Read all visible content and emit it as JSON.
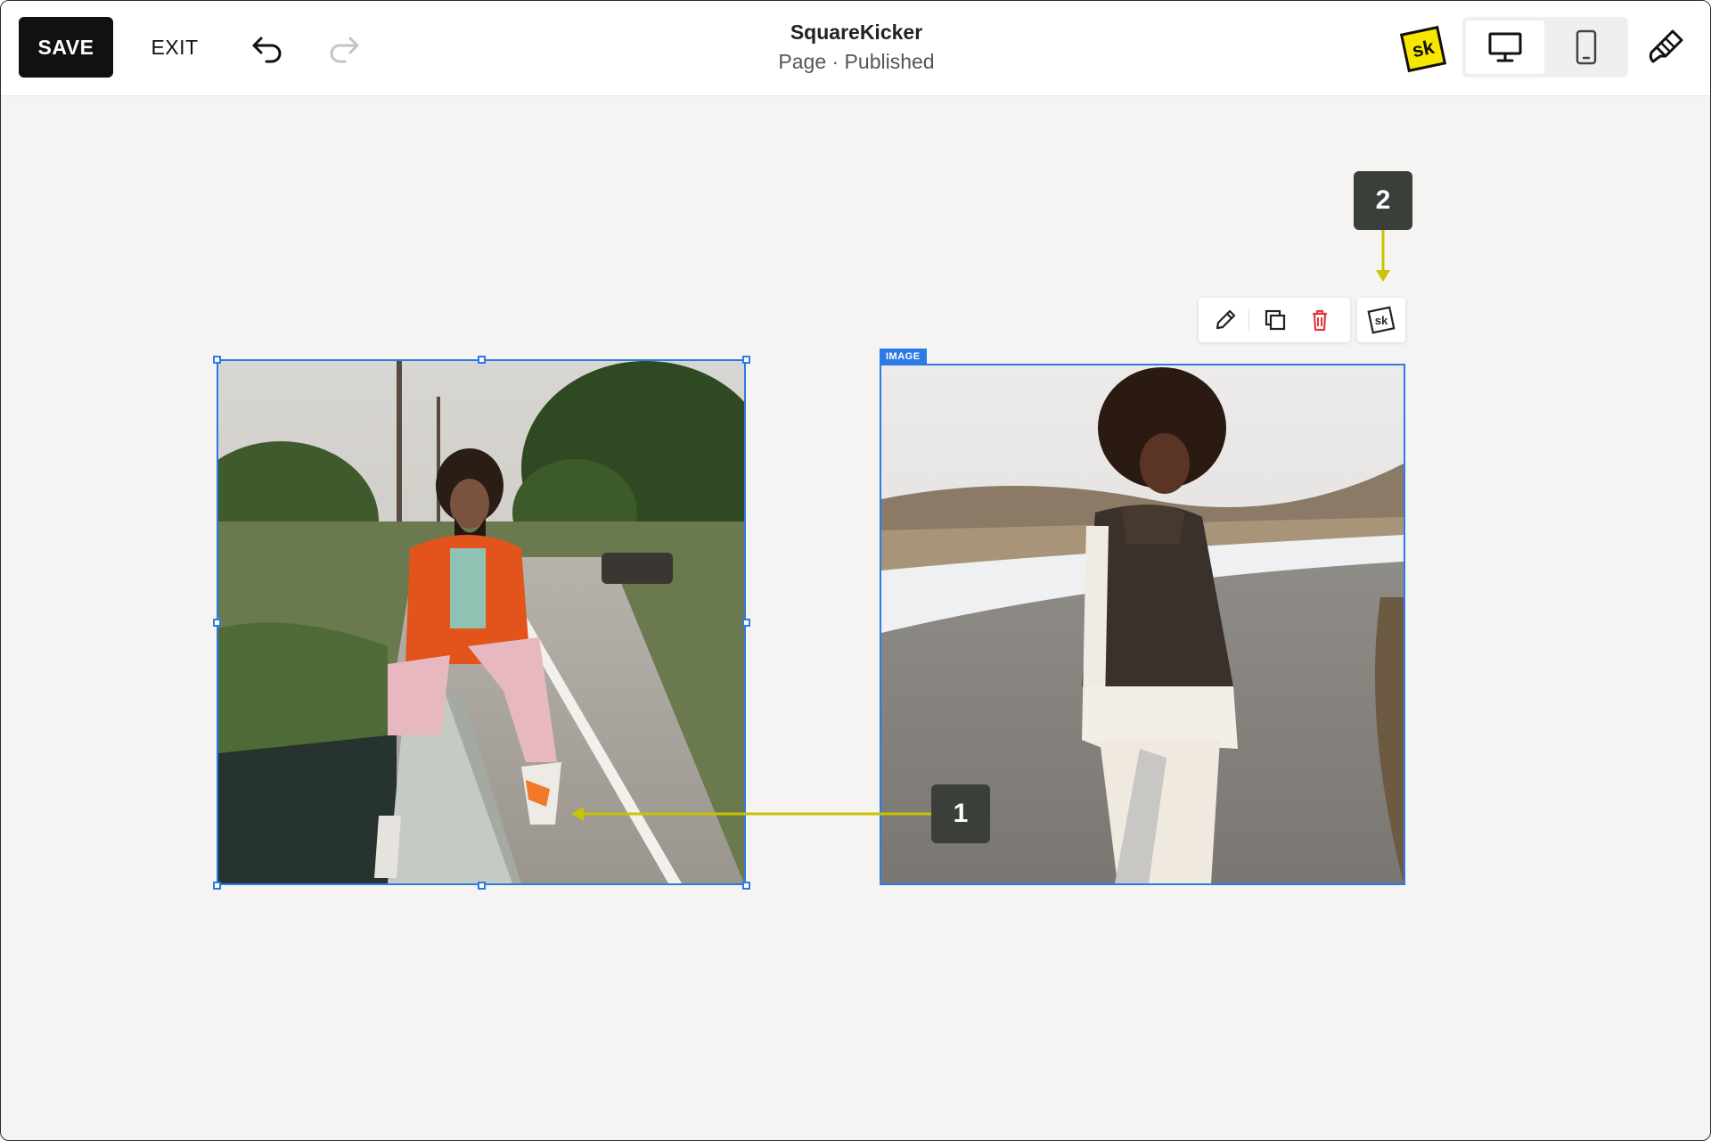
{
  "app": {
    "site_title": "SquareKicker",
    "page_status": "Page · Published"
  },
  "toolbar": {
    "save_label": "SAVE",
    "exit_label": "EXIT",
    "undo_icon": "undo-icon",
    "redo_icon": "redo-icon",
    "redo_enabled": false,
    "logo_text": "sk",
    "device_modes": [
      "desktop",
      "mobile"
    ],
    "active_device": "desktop"
  },
  "canvas": {
    "selected_block_label": "IMAGE",
    "block_toolbar": {
      "icons": [
        "pencil-icon",
        "duplicate-icon",
        "trash-icon",
        "squarekicker-icon"
      ],
      "sk_icon_text": "sk"
    },
    "callouts": [
      {
        "number": "1"
      },
      {
        "number": "2"
      }
    ]
  },
  "colors": {
    "selection": "#2c7be5",
    "callout_bg": "#3a3f3a",
    "callout_arrow": "#c8c400",
    "sk_yellow": "#f7e600",
    "delete_red": "#e0393e",
    "canvas_bg": "#f5f4f2"
  }
}
